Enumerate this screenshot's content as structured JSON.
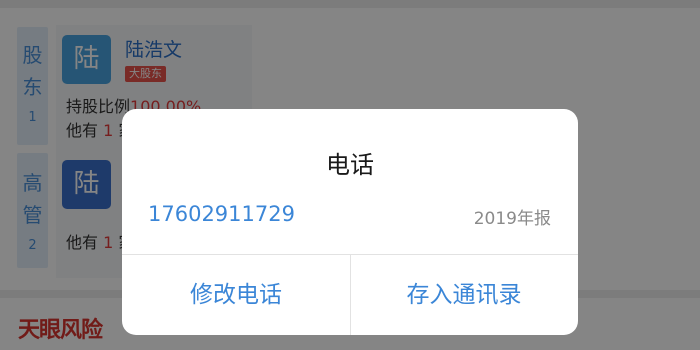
{
  "sections": [
    {
      "chars": [
        "股",
        "东"
      ],
      "count": "1"
    },
    {
      "chars": [
        "高",
        "管"
      ],
      "count": "2"
    }
  ],
  "people": [
    {
      "avatar": "陆",
      "name": "陆浩文",
      "tag": "大股东",
      "share_label": "持股比例",
      "share_value": "100.00%",
      "other_label": "他有",
      "other_count": "1",
      "other_suffix": "家"
    },
    {
      "avatar": "陆",
      "other_label": "他有",
      "other_count": "1",
      "other_suffix": "家"
    }
  ],
  "footer_logo": "天眼风险",
  "dialog": {
    "title": "电话",
    "phone": "17602911729",
    "report": "2019年报",
    "edit_button": "修改电话",
    "save_button": "存入通讯录"
  },
  "colors": {
    "accent": "#3b86d7",
    "avatar_light": "#4aa3e0",
    "avatar_dark": "#3a6fcb",
    "tag": "#e9534b"
  }
}
